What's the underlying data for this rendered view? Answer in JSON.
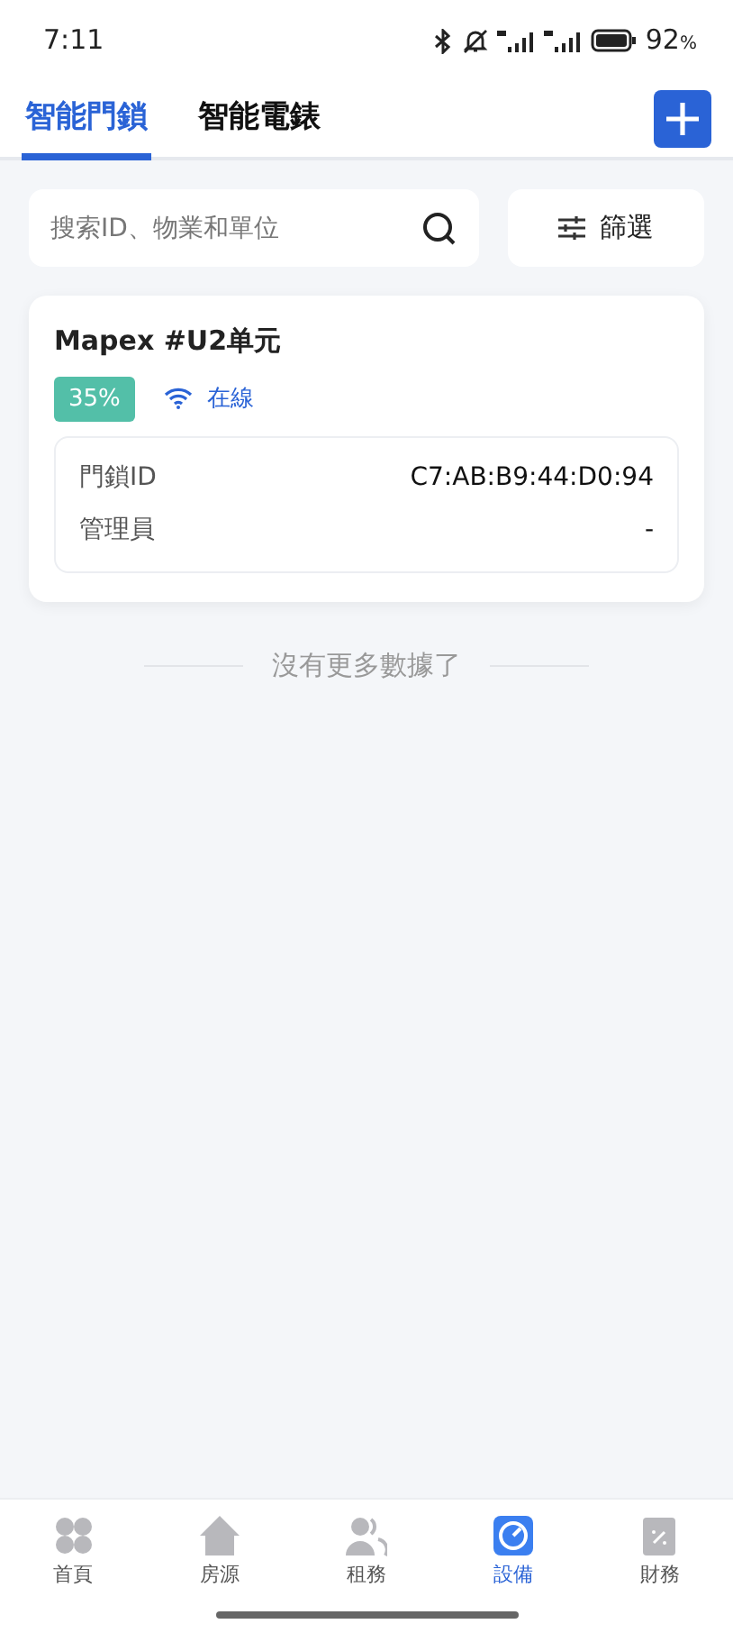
{
  "status_bar": {
    "time": "7:11",
    "battery": "92",
    "battery_unit": "%"
  },
  "tabs": [
    {
      "label": "智能門鎖",
      "selected": true
    },
    {
      "label": "智能電錶",
      "selected": false
    }
  ],
  "search": {
    "placeholder": "搜索ID、物業和單位"
  },
  "filter_button": "篩選",
  "devices": [
    {
      "title": "Mapex #U2单元",
      "battery": "35%",
      "online": true,
      "status": "在線",
      "fields": [
        {
          "label": "門鎖ID",
          "value": "C7:AB:B9:44:D0:94"
        },
        {
          "label": "管理員",
          "value": "-"
        }
      ]
    }
  ],
  "end_note": "沒有更多數據了",
  "bottom_nav": [
    {
      "label": "首頁",
      "kind": "grid",
      "selected": false
    },
    {
      "label": "房源",
      "kind": "house",
      "selected": false
    },
    {
      "label": "租務",
      "kind": "people",
      "selected": false
    },
    {
      "label": "設備",
      "kind": "gauge",
      "selected": true
    },
    {
      "label": "財務",
      "kind": "clipboard",
      "selected": false
    }
  ]
}
